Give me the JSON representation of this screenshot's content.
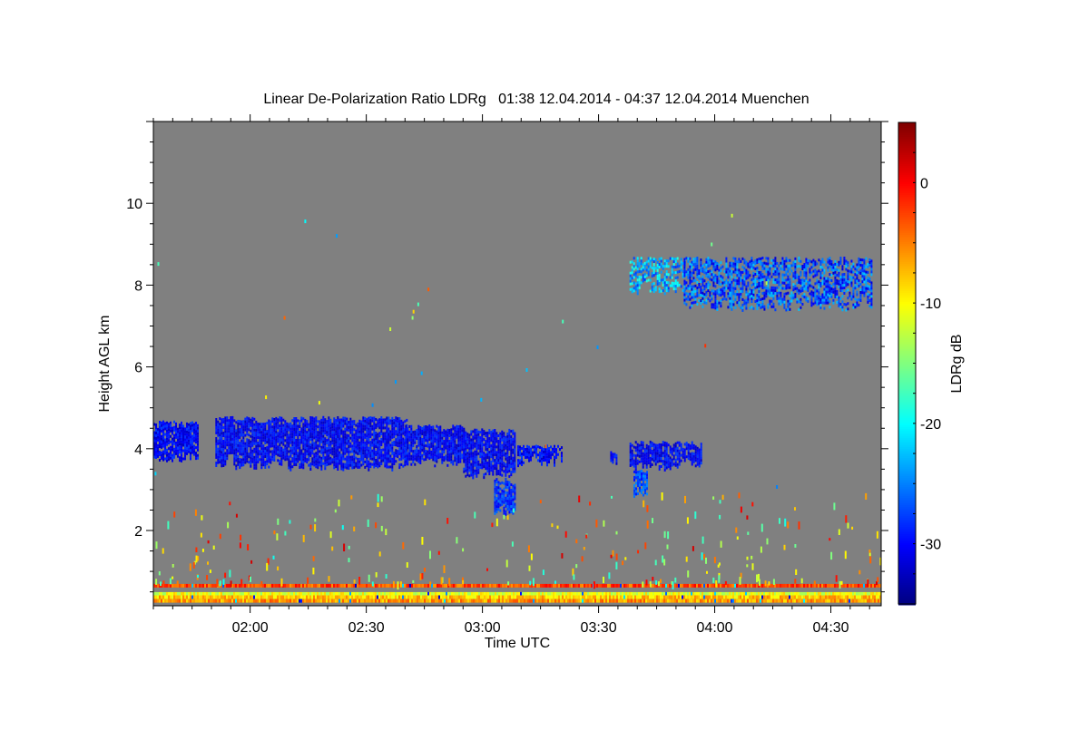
{
  "chart_data": {
    "type": "heatmap",
    "title": "Linear De-Polarization Ratio LDRg   01:38 12.04.2014 - 04:37 12.04.2014 Muenchen",
    "xlabel": "Time UTC",
    "ylabel": "Height AGL km",
    "colorbar_label": "LDRg dB",
    "xlim": [
      "01:35",
      "04:43"
    ],
    "ylim": [
      0.16,
      12.0
    ],
    "clim": [
      -35,
      5
    ],
    "colormap": "jet",
    "background_color": "#808080",
    "x_ticks": [
      "02:00",
      "02:30",
      "03:00",
      "03:30",
      "04:00",
      "04:30"
    ],
    "y_ticks": [
      2,
      4,
      6,
      8,
      10
    ],
    "colorbar_ticks": [
      0,
      -10,
      -20,
      -30
    ],
    "features": [
      {
        "t_start": "01:35",
        "t_end": "01:46",
        "h_bottom": 3.7,
        "h_top": 4.7,
        "ldr": -30
      },
      {
        "t_start": "01:51",
        "t_end": "02:40",
        "h_bottom": 3.5,
        "h_top": 4.8,
        "ldr": -30
      },
      {
        "t_start": "02:40",
        "t_end": "02:55",
        "h_bottom": 3.6,
        "h_top": 4.6,
        "ldr": -30
      },
      {
        "t_start": "02:55",
        "t_end": "03:08",
        "h_bottom": 3.3,
        "h_top": 4.5,
        "ldr": -30
      },
      {
        "t_start": "03:03",
        "t_end": "03:08",
        "h_bottom": 2.4,
        "h_top": 3.3,
        "ldr": -28
      },
      {
        "t_start": "03:09",
        "t_end": "03:20",
        "h_bottom": 3.6,
        "h_top": 4.1,
        "ldr": -30
      },
      {
        "t_start": "03:33",
        "t_end": "03:34",
        "h_bottom": 3.6,
        "h_top": 4.0,
        "ldr": -30
      },
      {
        "t_start": "03:38",
        "t_end": "03:56",
        "h_bottom": 3.5,
        "h_top": 4.2,
        "ldr": -30
      },
      {
        "t_start": "03:39",
        "t_end": "03:42",
        "h_bottom": 2.8,
        "h_top": 3.5,
        "ldr": -27
      },
      {
        "t_start": "03:38",
        "t_end": "03:52",
        "h_bottom": 7.8,
        "h_top": 8.7,
        "ldr": -23
      },
      {
        "t_start": "03:52",
        "t_end": "04:40",
        "h_bottom": 7.4,
        "h_top": 8.7,
        "ldr": -27
      }
    ],
    "near_ground_bands": [
      {
        "height": 0.65,
        "ldr": -3
      },
      {
        "height": 0.45,
        "ldr": -11
      },
      {
        "height": 0.37,
        "ldr": -8
      },
      {
        "height": 0.28,
        "ldr": -6
      }
    ]
  }
}
